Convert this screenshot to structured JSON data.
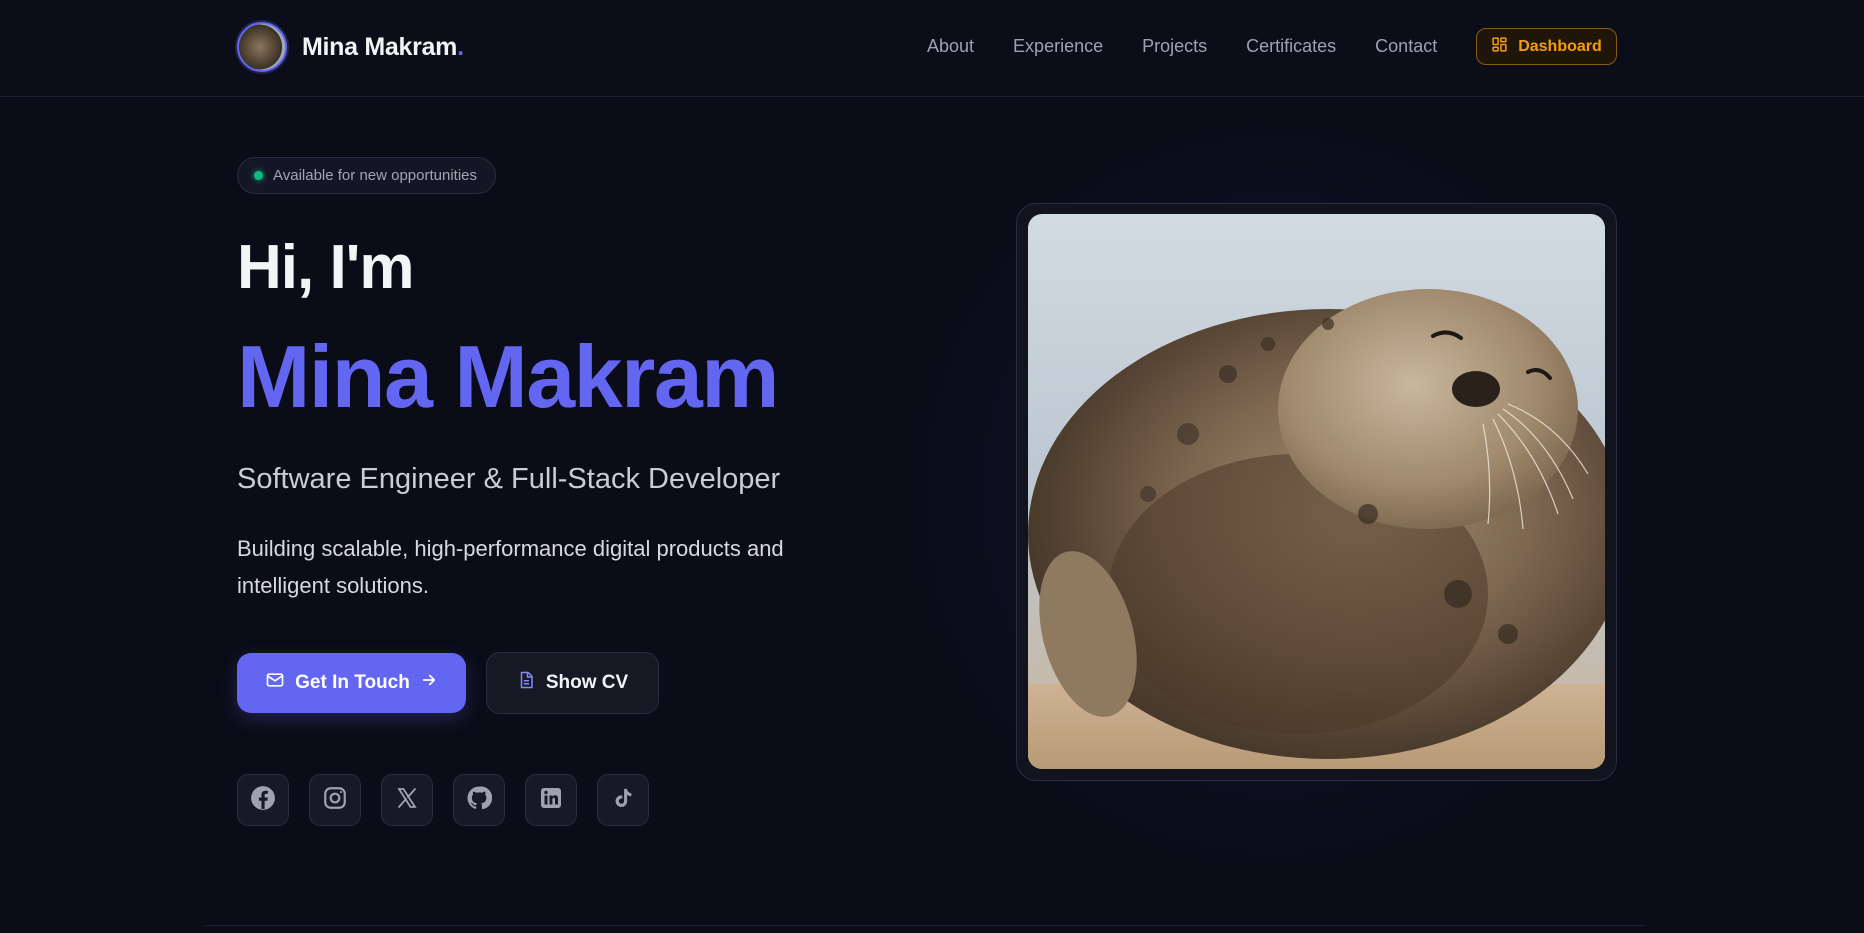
{
  "nav": {
    "brand_name": "Mina Makram",
    "brand_dot": ".",
    "links": [
      "About",
      "Experience",
      "Projects",
      "Certificates",
      "Contact"
    ],
    "dashboard_label": "Dashboard"
  },
  "hero": {
    "badge": "Available for new opportunities",
    "greeting": "Hi, I'm",
    "name": "Mina Makram",
    "role": "Software Engineer & Full-Stack Developer",
    "description": "Building scalable, high-performance digital products and intelligent solutions.",
    "primary_button": "Get In Touch",
    "secondary_button": "Show CV",
    "socials": [
      "facebook-icon",
      "instagram-icon",
      "x-icon",
      "github-icon",
      "linkedin-icon",
      "tiktok-icon"
    ]
  },
  "colors": {
    "accent": "#6366f1",
    "dashboard": "#f59e0b",
    "status": "#10b981",
    "background": "#0a0c17"
  }
}
